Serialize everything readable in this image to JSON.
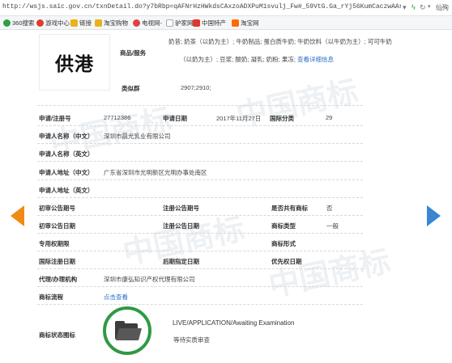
{
  "browser": {
    "url": "http://wsjs.saic.gov.cn/txnDetail.do?y7bRbp=qAFNrHzHWkdsCAxzoADXPuM1svulj_Fw#_59VtG.Ga_rYj56KumCaczwAArDymZ.y",
    "user_label": "仙殉"
  },
  "bookmarks": [
    {
      "label": "360搜索",
      "color": "#2ea043"
    },
    {
      "label": "游戏中心",
      "color": "#e03b2f"
    },
    {
      "label": "链接",
      "color": "#e8b21d"
    },
    {
      "label": "淘宝购物",
      "color": "#ff6a00"
    },
    {
      "label": "电视网-",
      "color": "#888888"
    },
    {
      "label": "驴家网",
      "color": "#8a8a8a"
    },
    {
      "label": "中国特产",
      "color": "#e0362c"
    },
    {
      "label": "淘宝网",
      "color": "#ff6a00"
    }
  ],
  "trademark": {
    "logo_text": "供港",
    "goods_services_label": "商品/服务",
    "goods_services_line1": "奶昔; 奶茶（以奶为主）; 牛奶制品; 蛋白质牛奶; 牛奶饮料（以牛奶为主）; 可可牛奶",
    "goods_services_line2": "（以奶为主）; 豆浆; 酸奶; 凝乳; 奶粉; 果冻;",
    "view_detail_link": "查看详细信息",
    "similar_group_label": "类似群",
    "similar_group_value": "2907;2910;",
    "reg_no_label": "申请/注册号",
    "reg_no_value": "27712386",
    "app_date_label": "申请日期",
    "app_date_value": "2017年11月27日",
    "intl_class_label": "国际分类",
    "intl_class_value": "29",
    "applicant_cn_label": "申请人名称（中文）",
    "applicant_cn_value": "深圳市晨光乳业有限公司",
    "applicant_en_label": "申请人名称（英文）",
    "address_cn_label": "申请人地址（中文）",
    "address_cn_value": "广东省深圳市光明新区光明办事处南区",
    "address_en_label": "申请人地址（英文）",
    "prelim_pub_no_label": "初审公告期号",
    "reg_pub_no_label": "注册公告期号",
    "shared_label": "是否共有商标",
    "shared_value": "否",
    "prelim_pub_date_label": "初审公告日期",
    "reg_pub_date_label": "注册公告日期",
    "type_label": "商标类型",
    "type_value": "一般",
    "exclusive_label": "专用权期限",
    "form_label": "商标形式",
    "intl_reg_date_label": "国际注册日期",
    "later_date_label": "后期指定日期",
    "priority_date_label": "优先权日期",
    "agency_label": "代理/办理机构",
    "agency_value": "深圳市康弘知识产权代理有限公司",
    "process_label": "商标流程",
    "process_link": "点击查看",
    "status_icon_label": "商标状态图标",
    "status_en": "LIVE/APPLICATION/Awaiting Examination",
    "status_cn": "等待实质审查"
  },
  "watermark_text": "中国商标"
}
